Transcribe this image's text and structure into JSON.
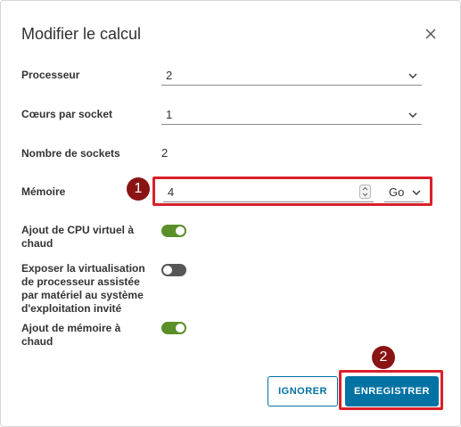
{
  "dialog": {
    "title": "Modifier le calcul"
  },
  "fields": {
    "processeur": {
      "label": "Processeur",
      "value": "2"
    },
    "coeurs": {
      "label": "Cœurs par socket",
      "value": "1"
    },
    "sockets": {
      "label": "Nombre de sockets",
      "value": "2"
    },
    "memoire": {
      "label": "Mémoire",
      "value": "4",
      "unit": "Go"
    },
    "cpu_hot_add": {
      "label": "Ajout de CPU virtuel à chaud",
      "enabled": true
    },
    "expose_virt": {
      "label": "Exposer la virtualisation de processeur assistée par matériel au système d'exploitation invité",
      "enabled": false
    },
    "mem_hot_add": {
      "label": "Ajout de mémoire à chaud",
      "enabled": true
    }
  },
  "buttons": {
    "cancel_label": "IGNORER",
    "save_label": "ENREGISTRER"
  },
  "markers": {
    "one": "1",
    "two": "2"
  },
  "colors": {
    "accent": "#0072a3",
    "toggle_on": "#5a8f29",
    "toggle_off": "#565656",
    "highlight": "#d9202a",
    "marker": "#8a1414"
  },
  "icons": {
    "close": "close-icon",
    "dropdown": "chevron-down-icon",
    "spinner": "spinner-arrows-icon"
  }
}
